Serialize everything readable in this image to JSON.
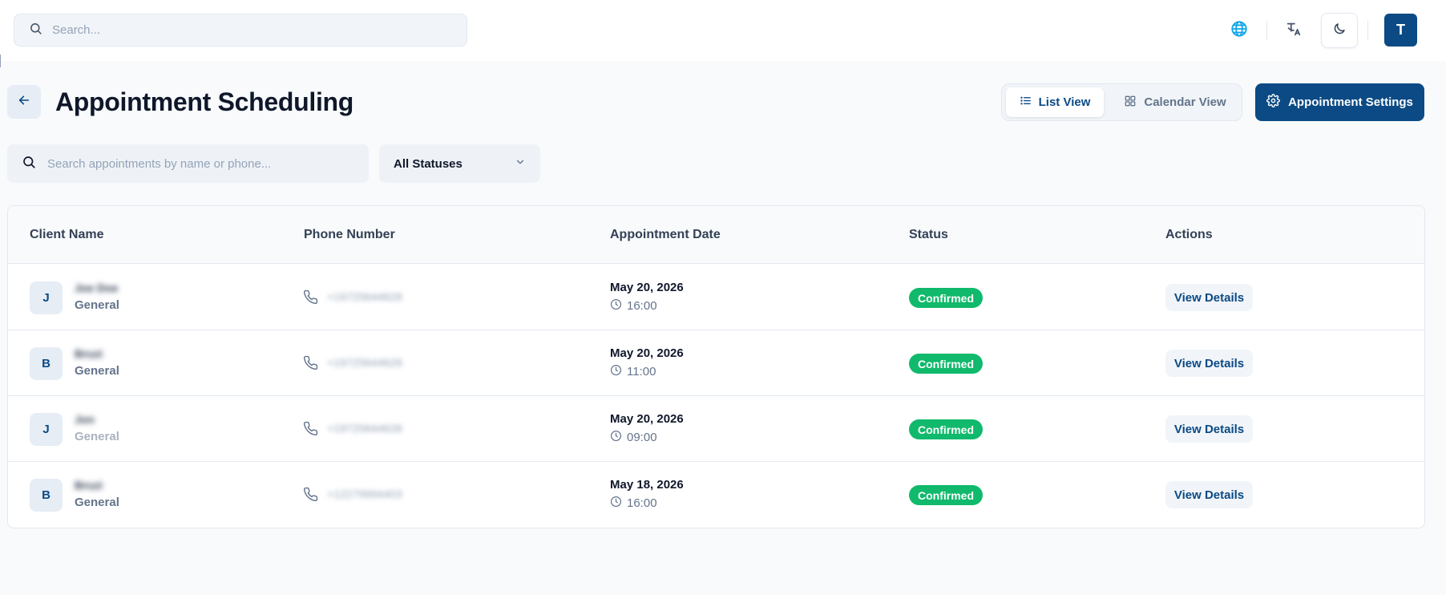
{
  "topbar": {
    "search_placeholder": "Search...",
    "avatar_initial": "T"
  },
  "header": {
    "title": "Appointment Scheduling",
    "list_view_label": "List View",
    "calendar_view_label": "Calendar View",
    "settings_label": "Appointment Settings"
  },
  "filters": {
    "search_placeholder": "Search appointments by name or phone...",
    "status_selected": "All Statuses"
  },
  "table": {
    "columns": [
      "Client Name",
      "Phone Number",
      "Appointment Date",
      "Status",
      "Actions"
    ],
    "rows": [
      {
        "initial": "J",
        "name": "Joe Doe",
        "category": "General",
        "phone": "+19725644628",
        "date": "May 20, 2026",
        "time": "16:00",
        "status": "Confirmed",
        "action": "View Details"
      },
      {
        "initial": "B",
        "name": "Bruzi",
        "category": "General",
        "phone": "+19725644628",
        "date": "May 20, 2026",
        "time": "11:00",
        "status": "Confirmed",
        "action": "View Details"
      },
      {
        "initial": "J",
        "name": "Jon",
        "category": "General",
        "phone": "+19725644628",
        "date": "May 20, 2026",
        "time": "09:00",
        "status": "Confirmed",
        "action": "View Details"
      },
      {
        "initial": "B",
        "name": "Bruzi",
        "category": "General",
        "phone": "+12279994403",
        "date": "May 18, 2026",
        "time": "16:00",
        "status": "Confirmed",
        "action": "View Details"
      }
    ]
  },
  "colors": {
    "primary": "#0b4a84",
    "confirmed": "#10b96b",
    "globe_icon": "#0ea5e9"
  },
  "icons": [
    "search-icon",
    "globe-icon",
    "translate-icon",
    "moon-icon",
    "arrow-left-icon",
    "list-icon",
    "grid-icon",
    "gear-icon",
    "chevron-down-icon",
    "phone-icon",
    "clock-icon"
  ]
}
